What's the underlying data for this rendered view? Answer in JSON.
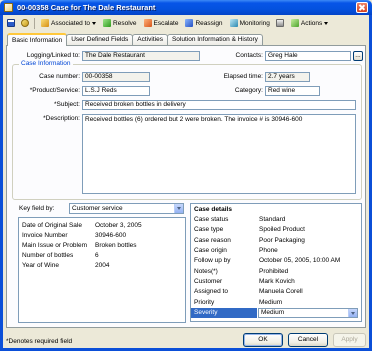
{
  "window": {
    "title": "00-00358 Case for The Dale Restaurant",
    "icon": "case-window-icon"
  },
  "toolbar": {
    "leading_icons": [
      "save-icon",
      "properties-icon"
    ],
    "items": [
      {
        "label": "Associated to",
        "icon": "link-icon",
        "has_dropdown": true
      },
      {
        "label": "Resolve",
        "icon": "resolve-icon",
        "has_dropdown": false
      },
      {
        "label": "Escalate",
        "icon": "escalate-icon",
        "has_dropdown": false
      },
      {
        "label": "Reassign",
        "icon": "reassign-icon",
        "has_dropdown": false
      },
      {
        "label": "Monitoring",
        "icon": "monitor-icon",
        "has_dropdown": false
      },
      {
        "icon": "print-icon",
        "has_dropdown": false
      },
      {
        "label": "Actions",
        "icon": "actions-icon",
        "has_dropdown": true
      }
    ]
  },
  "tabs": [
    {
      "label": "Basic Information",
      "selected": true
    },
    {
      "label": "User Defined Fields",
      "selected": false
    },
    {
      "label": "Activities",
      "selected": false
    },
    {
      "label": "Solution Information & History",
      "selected": false
    }
  ],
  "link": {
    "label": "Logging/Linked to:",
    "value": "The Dale Restaurant"
  },
  "contacts": {
    "label": "Contacts:",
    "value": "Greg Hale",
    "browse_label": "..."
  },
  "case_information": {
    "legend": "Case Information",
    "case_number": {
      "label": "Case number:",
      "value": "00-00358"
    },
    "elapsed_time": {
      "label": "Elapsed time:",
      "value": "2.7 years"
    },
    "product": {
      "label": "*Product/Service:",
      "value": "L.S.J Reds"
    },
    "category": {
      "label": "Category:",
      "value": "Red wine"
    },
    "subject": {
      "label": "*Subject:",
      "value": "Received broken bottles in delivery"
    },
    "description": {
      "label": "*Description:",
      "value": "Received bottles (6) ordered but 2 were broken. The invoice # is 30946-600"
    }
  },
  "key_fields": {
    "label": "Key field by:",
    "selected": "Customer service",
    "rows": [
      {
        "label": "Date of Original Sale",
        "value": "October 3, 2005"
      },
      {
        "label": "Invoice Number",
        "value": "30946-600"
      },
      {
        "label": "Main Issue or Problem",
        "value": "Broken bottles"
      },
      {
        "label": "Number of bottles",
        "value": "6"
      },
      {
        "label": "Year of Wine",
        "value": "2004"
      }
    ]
  },
  "case_details": {
    "title": "Case details",
    "rows": [
      {
        "label": "Case status",
        "value": "Standard"
      },
      {
        "label": "Case type",
        "value": "Spoiled Product"
      },
      {
        "label": "Case reason",
        "value": "Poor Packaging"
      },
      {
        "label": "Case origin",
        "value": "Phone"
      },
      {
        "label": "Follow up by",
        "value": "October 05, 2005, 10:00 AM"
      },
      {
        "label": "Notes(*)",
        "value": "Prohibited"
      },
      {
        "label": "Customer",
        "value": "Mark Kovich"
      },
      {
        "label": "Assigned to",
        "value": "Manuela Corell"
      },
      {
        "label": "Priority",
        "value": "Medium"
      },
      {
        "label": "Severity",
        "value": "Medium",
        "selected": true
      }
    ]
  },
  "footer": {
    "required_note": "*Denotes required field",
    "ok_label": "OK",
    "cancel_label": "Cancel",
    "apply_label": "Apply",
    "apply_enabled": false
  },
  "colors": {
    "title_bar": "#0452df",
    "window_frame": "#0b4fd8",
    "dialog_background": "#ece9d8",
    "selection": "#316ac5",
    "group_legend": "#0046d5",
    "active_tab_accent": "#ffc83c"
  }
}
